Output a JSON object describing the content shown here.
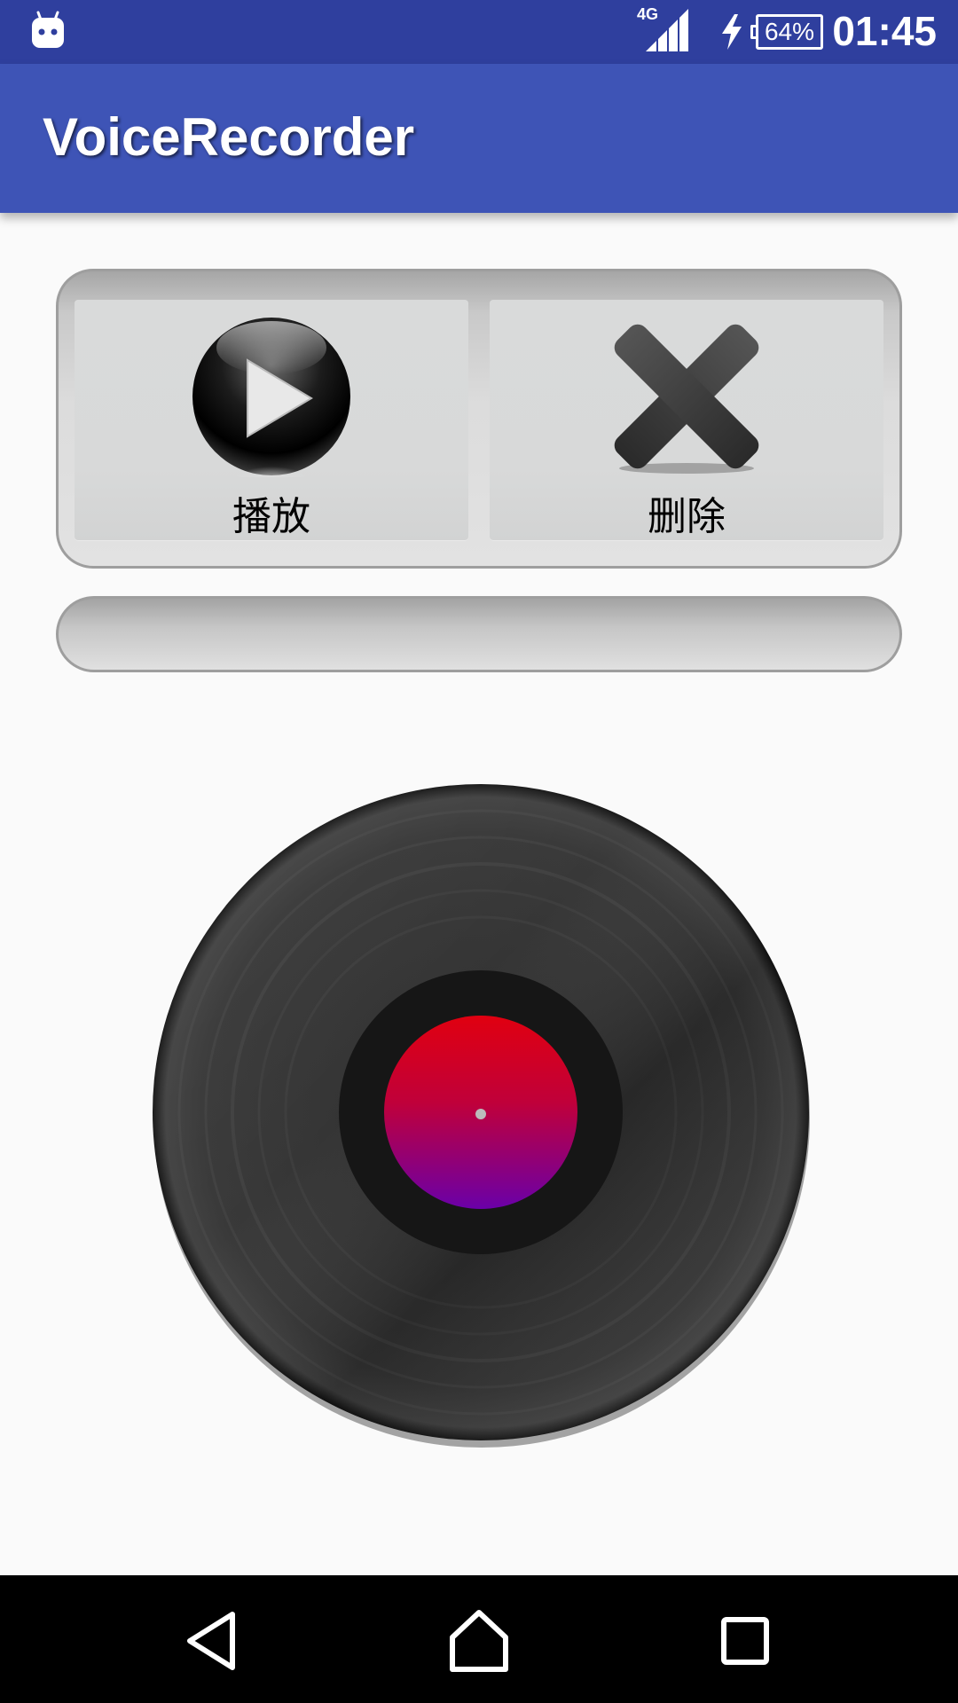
{
  "status_bar": {
    "network_type": "4G",
    "battery_percent": "64%",
    "battery_level": 64,
    "charging": true,
    "time": "01:45",
    "icons": [
      "android-icon",
      "signal-icon",
      "charging-bolt-icon",
      "battery-icon"
    ]
  },
  "app_bar": {
    "title": "VoiceRecorder",
    "color": "#3e54b6"
  },
  "controls": {
    "play": {
      "label": "播放",
      "icon": "play-icon"
    },
    "delete": {
      "label": "删除",
      "icon": "close-icon"
    }
  },
  "progress": {
    "value": 0
  },
  "record": {
    "icon": "vinyl-record-icon",
    "label_colors": [
      "#e00010",
      "#6a00a8"
    ]
  },
  "nav_bar": {
    "buttons": [
      "back-icon",
      "home-icon",
      "recents-icon"
    ]
  },
  "colors": {
    "status_bar": "#2f3f9e",
    "app_bar": "#3e54b6",
    "background": "#fafafa"
  }
}
